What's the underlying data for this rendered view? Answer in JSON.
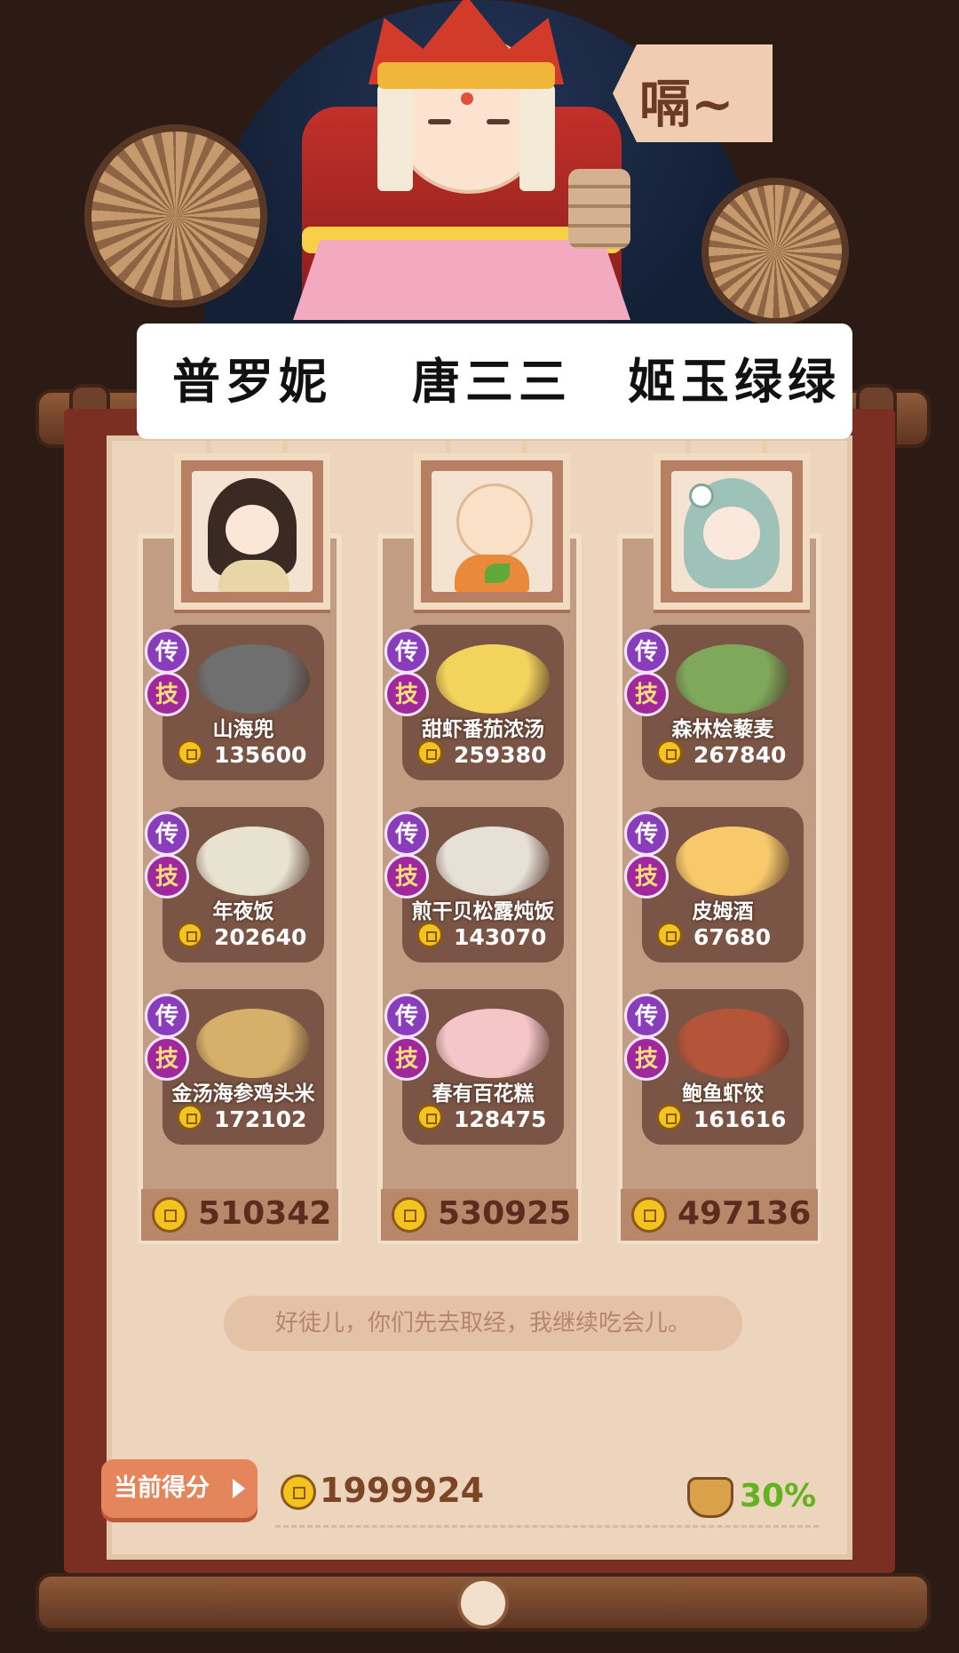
{
  "sign": {
    "text": "嗝~"
  },
  "players": [
    {
      "name": "普罗妮",
      "portrait_icon": "veiled-lady-avatar",
      "dishes": [
        {
          "name": "山海兜",
          "score": "135600",
          "icon": "dumpling-pan-icon",
          "badges": [
            "传",
            "技"
          ]
        },
        {
          "name": "年夜饭",
          "score": "202640",
          "icon": "feast-platter-icon",
          "badges": [
            "传",
            "技"
          ]
        },
        {
          "name": "金汤海参鸡头米",
          "score": "172102",
          "icon": "golden-soup-icon",
          "badges": [
            "传",
            "技"
          ]
        }
      ],
      "total": "510342"
    },
    {
      "name": "唐三三",
      "portrait_icon": "monk-avatar",
      "dishes": [
        {
          "name": "甜虾番茄浓汤",
          "score": "259380",
          "icon": "shrimp-soup-icon",
          "badges": [
            "传",
            "技"
          ]
        },
        {
          "name": "煎干贝松露炖饭",
          "score": "143070",
          "icon": "scallop-risotto-icon",
          "badges": [
            "传",
            "技"
          ]
        },
        {
          "name": "春有百花糕",
          "score": "128475",
          "icon": "flower-cake-icon",
          "badges": [
            "传",
            "技"
          ]
        }
      ],
      "total": "530925"
    },
    {
      "name": "姬玉绿绿",
      "portrait_icon": "green-hair-girl-avatar",
      "dishes": [
        {
          "name": "森林烩藜麦",
          "score": "267840",
          "icon": "forest-quinoa-icon",
          "badges": [
            "传",
            "技"
          ]
        },
        {
          "name": "皮姆酒",
          "score": "67680",
          "icon": "pimms-drink-icon",
          "badges": [
            "传",
            "技"
          ]
        },
        {
          "name": "鲍鱼虾饺",
          "score": "161616",
          "icon": "abalone-dumpling-icon",
          "badges": [
            "传",
            "技"
          ]
        }
      ],
      "total": "497136"
    }
  ],
  "speech": "好徒儿，你们先去取经，我继续吃会儿。",
  "current_score": {
    "label": "当前得分",
    "value": "1999924",
    "bonus": "30%"
  },
  "colors": {
    "coin": "#f5c31d",
    "badge_purple": "#8a3dba",
    "bonus_green": "#62b31f",
    "score_tag": "#e5855b"
  }
}
